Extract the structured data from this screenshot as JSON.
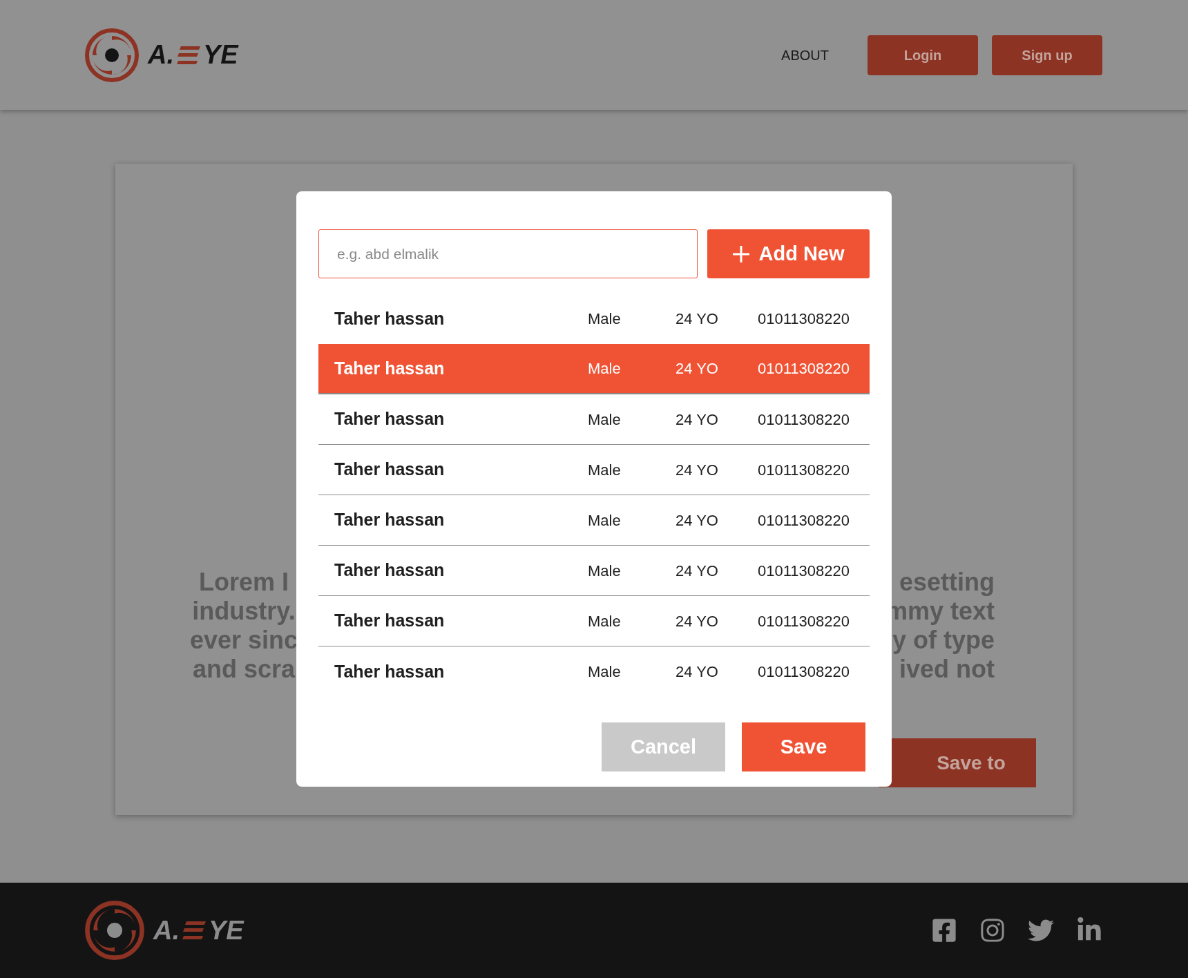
{
  "header": {
    "logo": {
      "first": "A.",
      "last": "YE"
    },
    "nav": [
      {
        "label": "ABOUT",
        "kind": "link"
      },
      {
        "label": "Login",
        "kind": "button"
      },
      {
        "label": "Sign up",
        "kind": "button"
      }
    ]
  },
  "background_card": {
    "text_left": [
      "Lorem I",
      "industry.",
      "ever sinc",
      "and scra"
    ],
    "text_right": [
      "esetting",
      "mmy text",
      "y of type",
      "ived not"
    ],
    "button": "Save to"
  },
  "modal": {
    "search": {
      "placeholder": "e.g. abd elmalik"
    },
    "add_button": "Add New",
    "rows": [
      {
        "name": "Taher hassan",
        "gender": "Male",
        "age": "24 YO",
        "phone": "01011308220",
        "selected": false
      },
      {
        "name": "Taher hassan",
        "gender": "Male",
        "age": "24 YO",
        "phone": "01011308220",
        "selected": true
      },
      {
        "name": "Taher hassan",
        "gender": "Male",
        "age": "24 YO",
        "phone": "01011308220",
        "selected": false
      },
      {
        "name": "Taher hassan",
        "gender": "Male",
        "age": "24 YO",
        "phone": "01011308220",
        "selected": false
      },
      {
        "name": "Taher hassan",
        "gender": "Male",
        "age": "24 YO",
        "phone": "01011308220",
        "selected": false
      },
      {
        "name": "Taher hassan",
        "gender": "Male",
        "age": "24 YO",
        "phone": "01011308220",
        "selected": false
      },
      {
        "name": "Taher hassan",
        "gender": "Male",
        "age": "24 YO",
        "phone": "01011308220",
        "selected": false
      },
      {
        "name": "Taher hassan",
        "gender": "Male",
        "age": "24 YO",
        "phone": "01011308220",
        "selected": false
      }
    ],
    "cancel": {
      "label": "Cancel",
      "disabled": true
    },
    "save": {
      "label": "Save"
    }
  },
  "footer": {
    "logo": {
      "first": "A.",
      "last": "YE"
    }
  }
}
